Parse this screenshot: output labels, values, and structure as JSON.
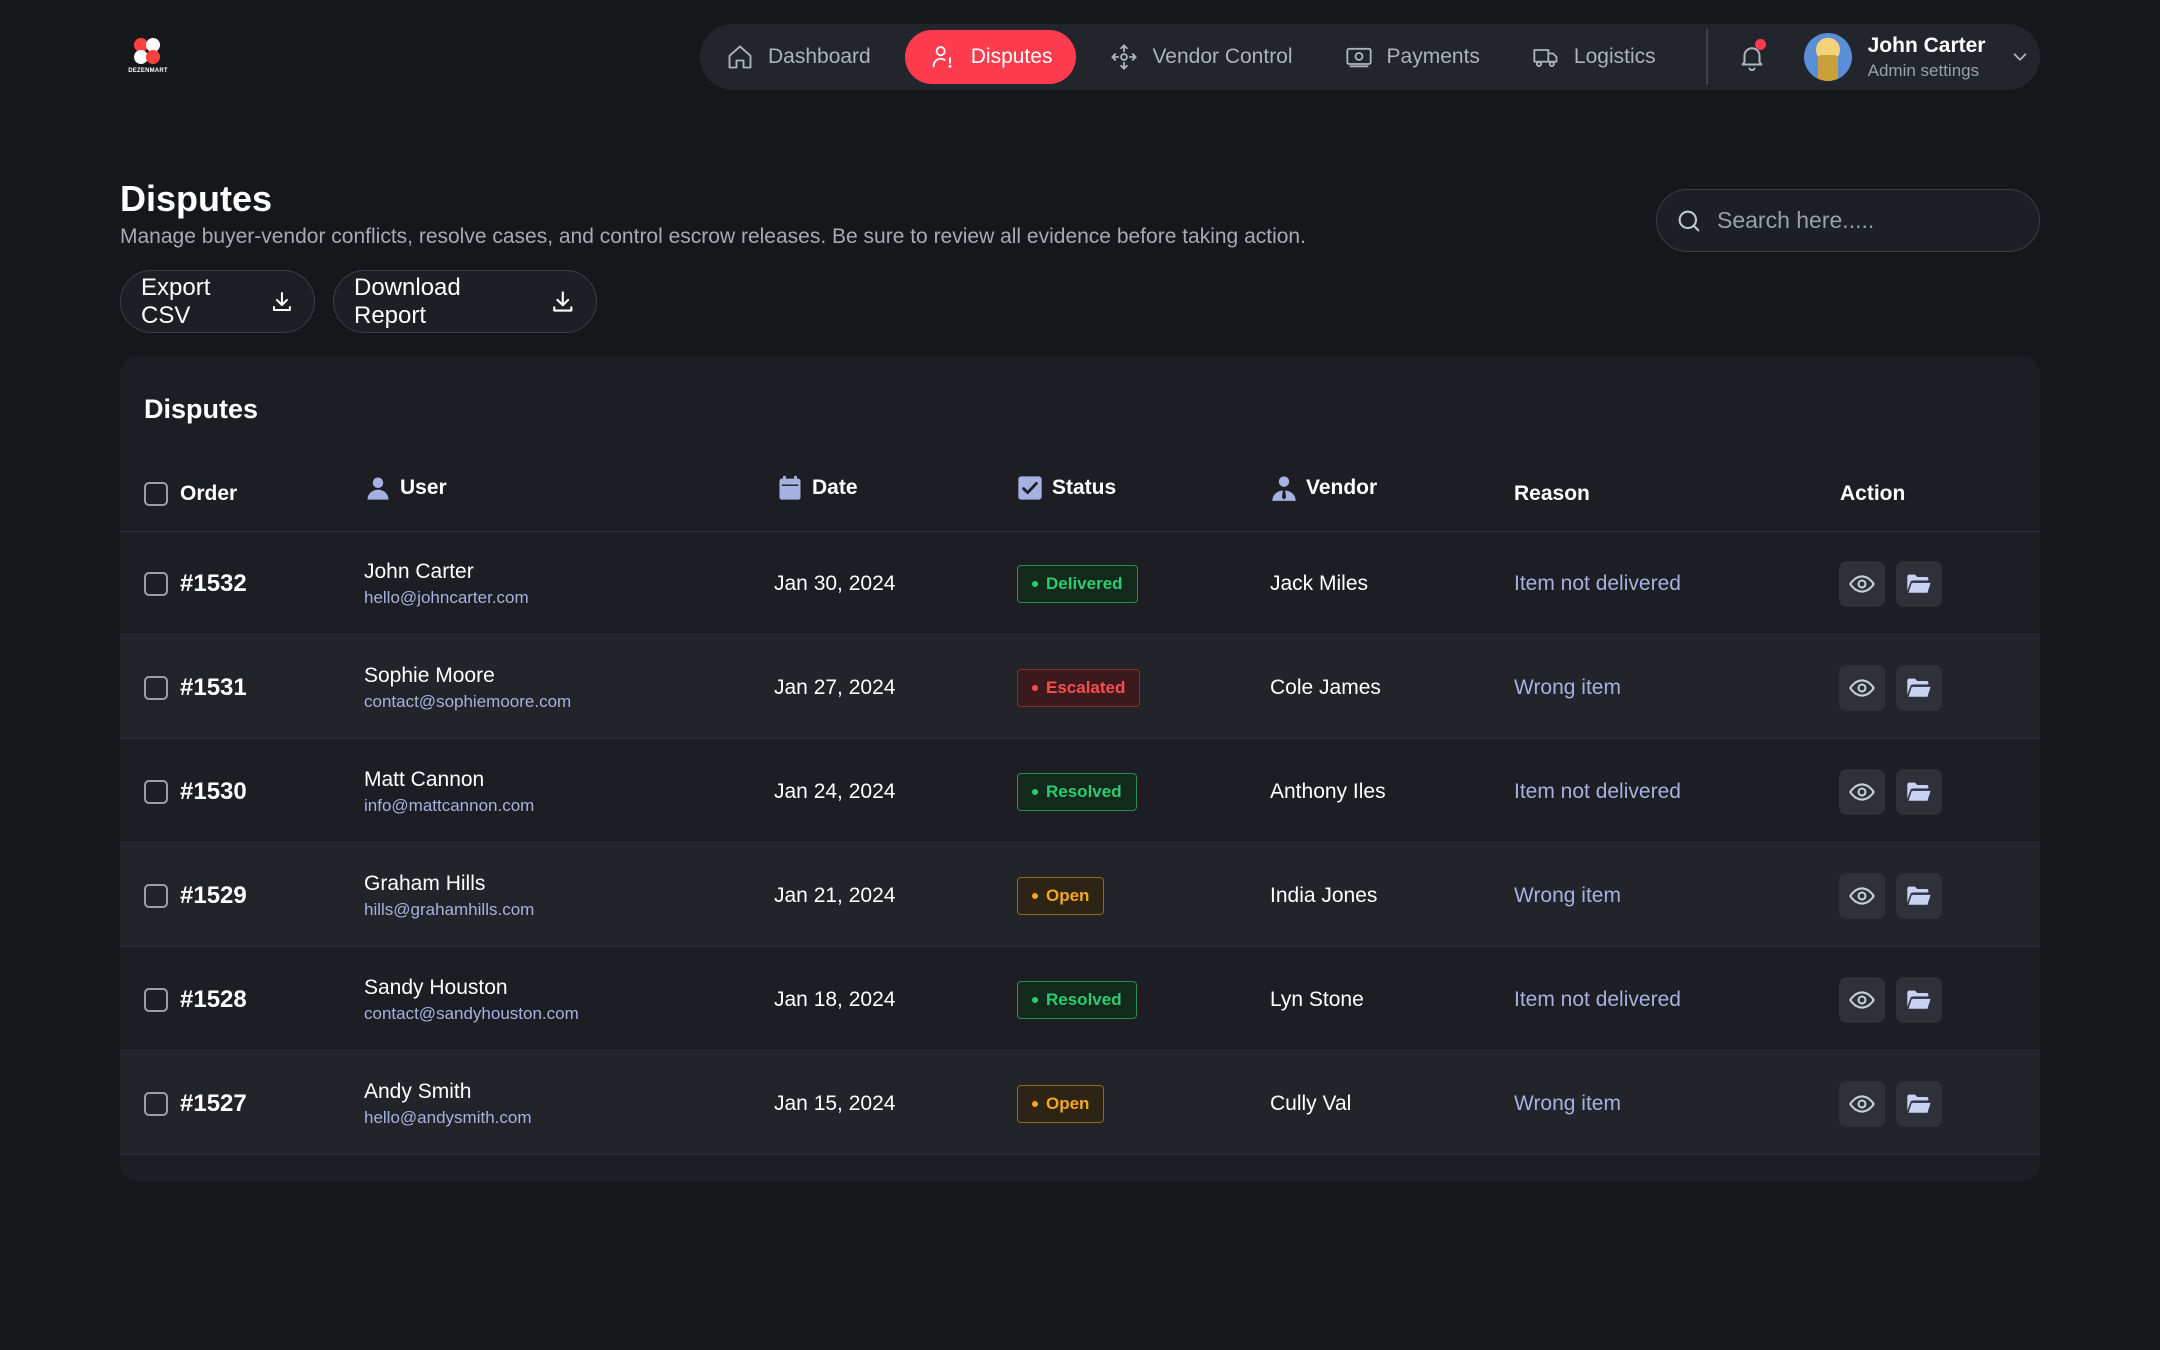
{
  "brand": {
    "name": "DEZENMART"
  },
  "nav": {
    "items": [
      {
        "label": "Dashboard",
        "icon": "home-icon"
      },
      {
        "label": "Disputes",
        "icon": "user-alert-icon",
        "active": true
      },
      {
        "label": "Vendor Control",
        "icon": "move-arrows-icon"
      },
      {
        "label": "Payments",
        "icon": "money-icon"
      },
      {
        "label": "Logistics",
        "icon": "truck-icon"
      }
    ],
    "notification_icon": "bell-icon",
    "user": {
      "name": "John Carter",
      "subtitle": "Admin settings"
    }
  },
  "header": {
    "title": "Disputes",
    "description": "Manage buyer-vendor conflicts, resolve cases, and control escrow releases. Be sure to review all evidence before taking action.",
    "search_placeholder": "Search here.....",
    "export_label": "Export CSV",
    "report_label": "Download Report"
  },
  "table": {
    "title": "Disputes",
    "columns": {
      "order": "Order",
      "user": "User",
      "date": "Date",
      "status": "Status",
      "vendor": "Vendor",
      "reason": "Reason",
      "action": "Action"
    },
    "rows": [
      {
        "order": "#1532",
        "user": "John Carter",
        "email": "hello@johncarter.com",
        "date": "Jan 30, 2024",
        "status": "Delivered",
        "status_color": "green",
        "vendor": "Jack Miles",
        "reason": "Item not delivered"
      },
      {
        "order": "#1531",
        "user": "Sophie Moore",
        "email": "contact@sophiemoore.com",
        "date": "Jan 27, 2024",
        "status": "Escalated",
        "status_color": "red",
        "vendor": "Cole James",
        "reason": "Wrong item"
      },
      {
        "order": "#1530",
        "user": "Matt Cannon",
        "email": "info@mattcannon.com",
        "date": "Jan 24, 2024",
        "status": "Resolved",
        "status_color": "green",
        "vendor": "Anthony Iles",
        "reason": "Item not delivered"
      },
      {
        "order": "#1529",
        "user": "Graham Hills",
        "email": "hills@grahamhills.com",
        "date": "Jan 21, 2024",
        "status": "Open",
        "status_color": "amber",
        "vendor": "India Jones",
        "reason": "Wrong item"
      },
      {
        "order": "#1528",
        "user": "Sandy Houston",
        "email": "contact@sandyhouston.com",
        "date": "Jan 18, 2024",
        "status": "Resolved",
        "status_color": "green",
        "vendor": "Lyn Stone",
        "reason": "Item not delivered"
      },
      {
        "order": "#1527",
        "user": "Andy Smith",
        "email": "hello@andysmith.com",
        "date": "Jan 15, 2024",
        "status": "Open",
        "status_color": "amber",
        "vendor": "Cully Val",
        "reason": "Wrong item"
      }
    ]
  },
  "colors": {
    "accent": "#ff3b4e",
    "background": "#15171b",
    "card": "#1c1e23",
    "link": "#a5b1e0"
  }
}
